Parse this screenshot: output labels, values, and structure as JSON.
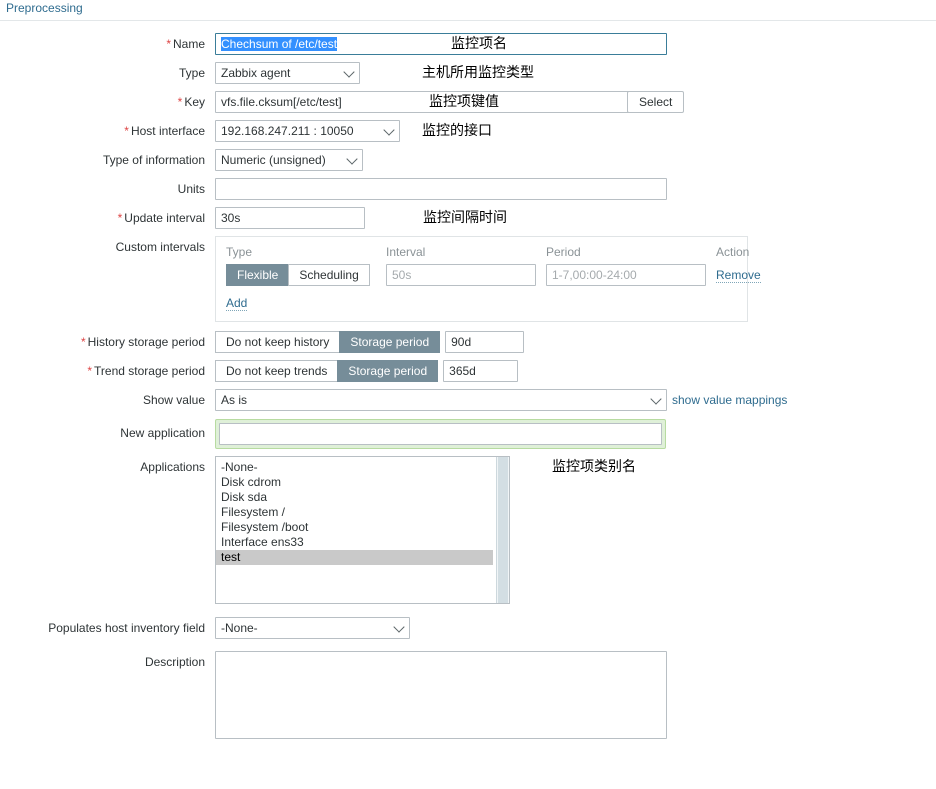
{
  "tabs": {
    "preprocessing_label": "Preprocessing"
  },
  "form": {
    "name": {
      "label": "Name",
      "required": true,
      "value": "Chechsum of /etc/test",
      "annotation": "监控项名"
    },
    "type": {
      "label": "Type",
      "required": false,
      "value": "Zabbix agent",
      "annotation": "主机所用监控类型"
    },
    "key": {
      "label": "Key",
      "required": true,
      "value": "vfs.file.cksum[/etc/test]",
      "select_button": "Select",
      "annotation": "监控项键值"
    },
    "host_interface": {
      "label": "Host interface",
      "required": true,
      "value": "192.168.247.211 : 10050",
      "annotation": "监控的接口"
    },
    "type_of_information": {
      "label": "Type of information",
      "required": false,
      "value": "Numeric (unsigned)"
    },
    "units": {
      "label": "Units",
      "required": false,
      "value": ""
    },
    "update_interval": {
      "label": "Update interval",
      "required": true,
      "value": "30s",
      "annotation": "监控间隔时间"
    },
    "custom_intervals": {
      "label": "Custom intervals",
      "columns": [
        "Type",
        "Interval",
        "Period",
        "Action"
      ],
      "rows": [
        {
          "type_options": [
            "Flexible",
            "Scheduling"
          ],
          "type_selected": "Flexible",
          "interval_value": "",
          "interval_placeholder": "50s",
          "period_value": "",
          "period_placeholder": "1-7,00:00-24:00",
          "action_label": "Remove"
        }
      ],
      "add_label": "Add"
    },
    "history_storage_period": {
      "label": "History storage period",
      "required": true,
      "options": [
        "Do not keep history",
        "Storage period"
      ],
      "selected": "Storage period",
      "value": "90d"
    },
    "trend_storage_period": {
      "label": "Trend storage period",
      "required": true,
      "options": [
        "Do not keep trends",
        "Storage period"
      ],
      "selected": "Storage period",
      "value": "365d"
    },
    "show_value": {
      "label": "Show value",
      "required": false,
      "value": "As is",
      "link_label": "show value mappings"
    },
    "new_application": {
      "label": "New application",
      "required": false,
      "value": "",
      "highlight_color": "#dff0d8"
    },
    "applications": {
      "label": "Applications",
      "options": [
        "-None-",
        "Disk cdrom",
        "Disk sda",
        "Filesystem /",
        "Filesystem /boot",
        "Interface ens33",
        "test"
      ],
      "selected": "test",
      "annotation": "监控项类别名"
    },
    "host_inventory_field": {
      "label": "Populates host inventory field",
      "required": false,
      "value": "-None-"
    },
    "description": {
      "label": "Description",
      "required": false,
      "value": ""
    }
  },
  "colors": {
    "link": "#2f6c8f",
    "required_star": "#dd4444",
    "toggle_active_bg": "#768d99",
    "selection_bg": "#3390ff",
    "highlight_bg": "#dff0d8",
    "listbox_selected_bg": "#c9c9c9"
  }
}
